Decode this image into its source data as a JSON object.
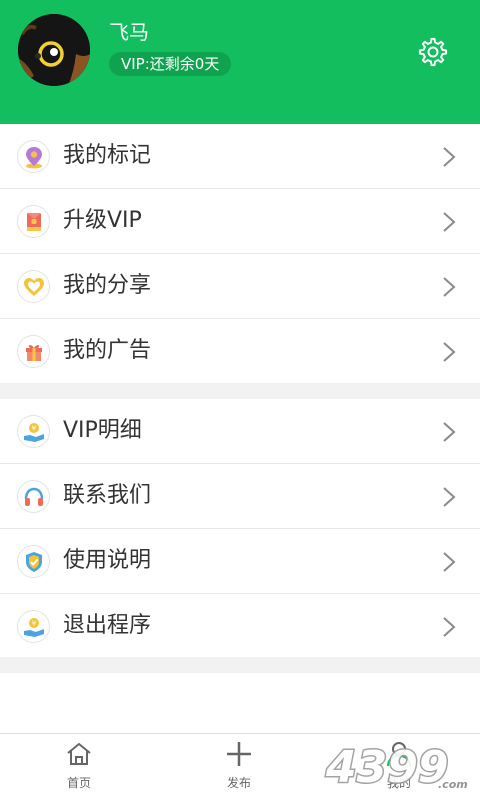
{
  "profile": {
    "username": "飞马",
    "vip_status": "VIP:还剩余0天"
  },
  "menu_group_1": [
    {
      "label": "我的标记",
      "icon": "location-pin-icon"
    },
    {
      "label": "升级VIP",
      "icon": "red-envelope-icon"
    },
    {
      "label": "我的分享",
      "icon": "heart-icon"
    },
    {
      "label": "我的广告",
      "icon": "gift-icon"
    }
  ],
  "menu_group_2": [
    {
      "label": "VIP明细",
      "icon": "coin-hand-icon"
    },
    {
      "label": "联系我们",
      "icon": "headphones-icon"
    },
    {
      "label": "使用说明",
      "icon": "shield-check-icon"
    },
    {
      "label": "退出程序",
      "icon": "coin-hand-icon"
    }
  ],
  "tabbar": [
    {
      "label": "首页",
      "icon": "home-icon"
    },
    {
      "label": "发布",
      "icon": "plus-icon"
    },
    {
      "label": "我的",
      "icon": "user-icon"
    }
  ],
  "colors": {
    "accent": "#12be5e",
    "background": "#ffffff",
    "separator": "#f2f2f2"
  }
}
